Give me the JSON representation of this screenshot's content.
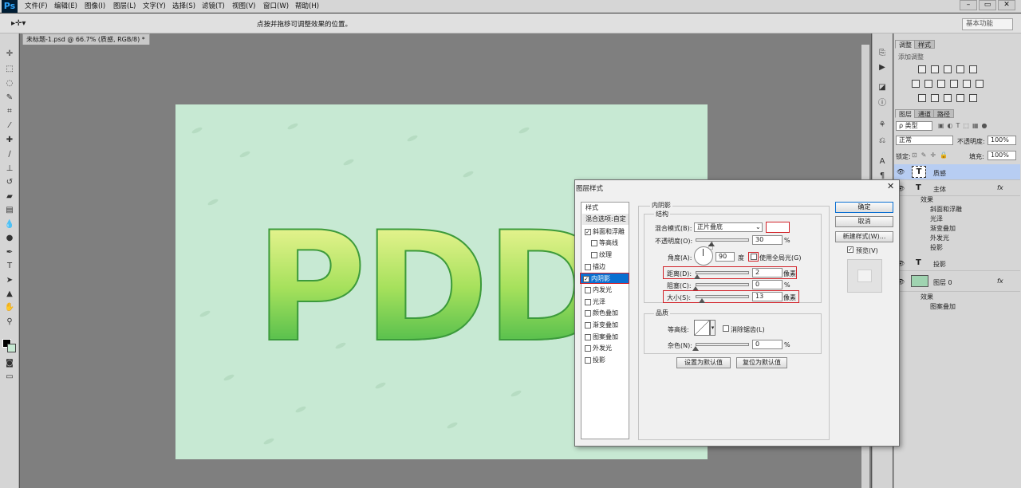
{
  "app": {
    "logo": "Ps"
  },
  "menu": [
    "文件(F)",
    "编辑(E)",
    "图像(I)",
    "图层(L)",
    "文字(Y)",
    "选择(S)",
    "滤镜(T)",
    "视图(V)",
    "窗口(W)",
    "帮助(H)"
  ],
  "window_buttons": [
    "–",
    "▭",
    "✕"
  ],
  "options": {
    "hint": "点按并拖移可调整效果的位置。",
    "workspace": "基本功能"
  },
  "document": {
    "tab": "未标题-1.psd @ 66.7% (质感, RGB/8) *",
    "text": "PDDS"
  },
  "panels": {
    "top_tabs": [
      "调整",
      "样式"
    ],
    "add_adjustment": "添加调整",
    "layers_tabs": [
      "图层",
      "通道",
      "路径"
    ],
    "filter_kind": "ρ 类型",
    "blend_mode": "正常",
    "opacity_label": "不透明度:",
    "opacity_value": "100%",
    "lock_label": "锁定:",
    "fill_label": "填充:",
    "fill_value": "100%"
  },
  "layers": [
    {
      "name": "质感",
      "type": "T",
      "selected": true
    },
    {
      "name": "主体",
      "type": "T",
      "fx": "fx"
    },
    {
      "name": "投影",
      "type": "T"
    },
    {
      "name": "图层 0",
      "type": "image",
      "fx": "fx"
    }
  ],
  "layer_effects": {
    "main": [
      "效果",
      "斜面和浮雕",
      "光泽",
      "渐变叠加",
      "外发光",
      "投影"
    ],
    "layer0": [
      "效果",
      "图案叠加"
    ]
  },
  "dialog": {
    "title": "图层样式",
    "close": "✕",
    "styles_header": "样式",
    "blend_options": "混合选项:自定",
    "style_items": [
      {
        "label": "斜面和浮雕",
        "checked": true
      },
      {
        "label": "等高线",
        "checked": false,
        "indent": true
      },
      {
        "label": "纹理",
        "checked": false,
        "indent": true
      },
      {
        "label": "描边",
        "checked": false
      },
      {
        "label": "内阴影",
        "checked": true,
        "active": true
      },
      {
        "label": "内发光",
        "checked": false
      },
      {
        "label": "光泽",
        "checked": false
      },
      {
        "label": "颜色叠加",
        "checked": false
      },
      {
        "label": "渐变叠加",
        "checked": false
      },
      {
        "label": "图案叠加",
        "checked": false
      },
      {
        "label": "外发光",
        "checked": false
      },
      {
        "label": "投影",
        "checked": false
      }
    ],
    "section_title": "内阴影",
    "structure": "结构",
    "blend_mode_label": "混合模式(B):",
    "blend_mode_value": "正片叠底",
    "opacity_label": "不透明度(O):",
    "opacity_value": "30",
    "opacity_percent": 30,
    "percent": "%",
    "angle_label": "角度(A):",
    "angle_value": "90",
    "degree": "度",
    "global_light": "使用全局光(G)",
    "distance_label": "距离(D):",
    "distance_value": "2",
    "distance_unit": "像素",
    "choke_label": "阻塞(C):",
    "choke_value": "0",
    "size_label": "大小(S):",
    "size_value": "13",
    "size_unit": "像素",
    "quality": "品质",
    "contour_label": "等高线:",
    "antialias": "消除锯齿(L)",
    "noise_label": "杂色(N):",
    "noise_value": "0",
    "set_default": "设置为默认值",
    "reset_default": "复位为默认值",
    "ok": "确定",
    "cancel": "取消",
    "new_style": "新建样式(W)...",
    "preview": "预览(V)"
  },
  "colors": {
    "accent": "#0a6fd1",
    "canvas": "#c7e9d3",
    "red_highlight": "#d2232a"
  }
}
